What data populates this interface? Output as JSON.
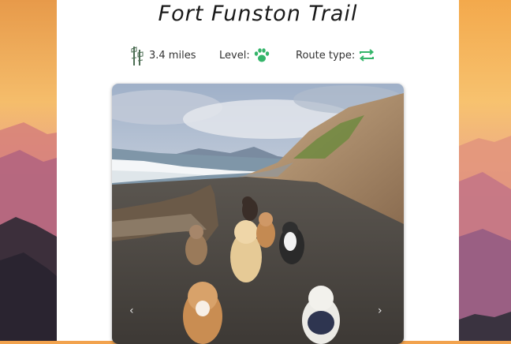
{
  "trail": {
    "title": "Fort Funston Trail",
    "distance": "3.4 miles",
    "level_label": "Level:",
    "route_label": "Route type:"
  },
  "icons": {
    "distance": "trail-signpost-icon",
    "level": "paw-icon",
    "route": "loop-arrows-icon"
  },
  "colors": {
    "accent_green": "#35b56a",
    "signpost": "#4d6e54"
  },
  "carousel": {
    "prev": "‹",
    "next": "›"
  }
}
